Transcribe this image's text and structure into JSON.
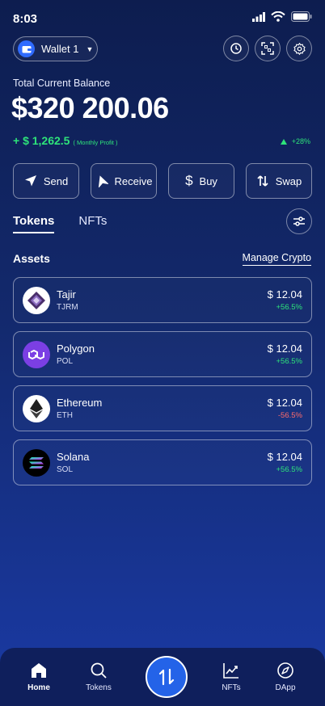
{
  "status": {
    "time": "8:03"
  },
  "wallet": {
    "name": "Wallet 1"
  },
  "balance": {
    "label": "Total Current Balance",
    "value": "$320 200.06",
    "profit": "+ $ 1,262.5",
    "profit_note": "( Monthly Profit )",
    "percent": "+28%"
  },
  "actions": [
    {
      "label": "Send",
      "icon": "send-icon"
    },
    {
      "label": "Receive",
      "icon": "receive-icon"
    },
    {
      "label": "Buy",
      "icon": "dollar-icon"
    },
    {
      "label": "Swap",
      "icon": "swap-icon"
    }
  ],
  "tabs": [
    {
      "label": "Tokens",
      "active": true
    },
    {
      "label": "NFTs",
      "active": false
    }
  ],
  "assets": {
    "title": "Assets",
    "manage_label": "Manage Crypto",
    "items": [
      {
        "name": "Tajir",
        "symbol": "TJRM",
        "price": "$ 12.04",
        "change": "+56.5%",
        "direction": "up",
        "icon": "tajir-logo-icon"
      },
      {
        "name": "Polygon",
        "symbol": "POL",
        "price": "$ 12.04",
        "change": "+56.5%",
        "direction": "up",
        "icon": "polygon-logo-icon"
      },
      {
        "name": "Ethereum",
        "symbol": "ETH",
        "price": "$ 12.04",
        "change": "-56.5%",
        "direction": "down",
        "icon": "ethereum-logo-icon"
      },
      {
        "name": "Solana",
        "symbol": "SOL",
        "price": "$ 12.04",
        "change": "+56.5%",
        "direction": "up",
        "icon": "solana-logo-icon"
      }
    ]
  },
  "nav": [
    {
      "label": "Home",
      "active": true,
      "icon": "home-icon"
    },
    {
      "label": "Tokens",
      "active": false,
      "icon": "search-icon"
    },
    {
      "label": "NFTs",
      "active": false,
      "icon": "chart-icon"
    },
    {
      "label": "DApp",
      "active": false,
      "icon": "compass-icon"
    }
  ],
  "colors": {
    "positive": "#2ee37a",
    "negative": "#ff6b6b",
    "accent": "#2463e8",
    "background": "#13296d"
  }
}
